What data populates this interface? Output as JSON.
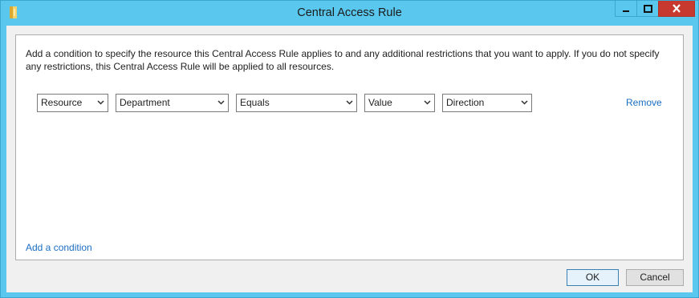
{
  "window": {
    "title": "Central Access Rule",
    "colors": {
      "frame": "#5ac8ee",
      "close": "#c7392e",
      "link": "#1b6ec2"
    },
    "controls": {
      "minimize_icon": "minimize-icon",
      "maximize_icon": "maximize-icon",
      "close_icon": "close-icon"
    }
  },
  "description": "Add a condition to specify the resource this Central Access Rule applies to and any additional restrictions that you want to apply. If you do not specify any restrictions, this Central Access Rule will be applied to all resources.",
  "condition": {
    "attribute_type": "Resource",
    "attribute": "Department",
    "operator": "Equals",
    "value_type": "Value",
    "value": "Direction",
    "remove_label": "Remove"
  },
  "add_condition_label": "Add a condition",
  "buttons": {
    "ok": "OK",
    "cancel": "Cancel"
  }
}
